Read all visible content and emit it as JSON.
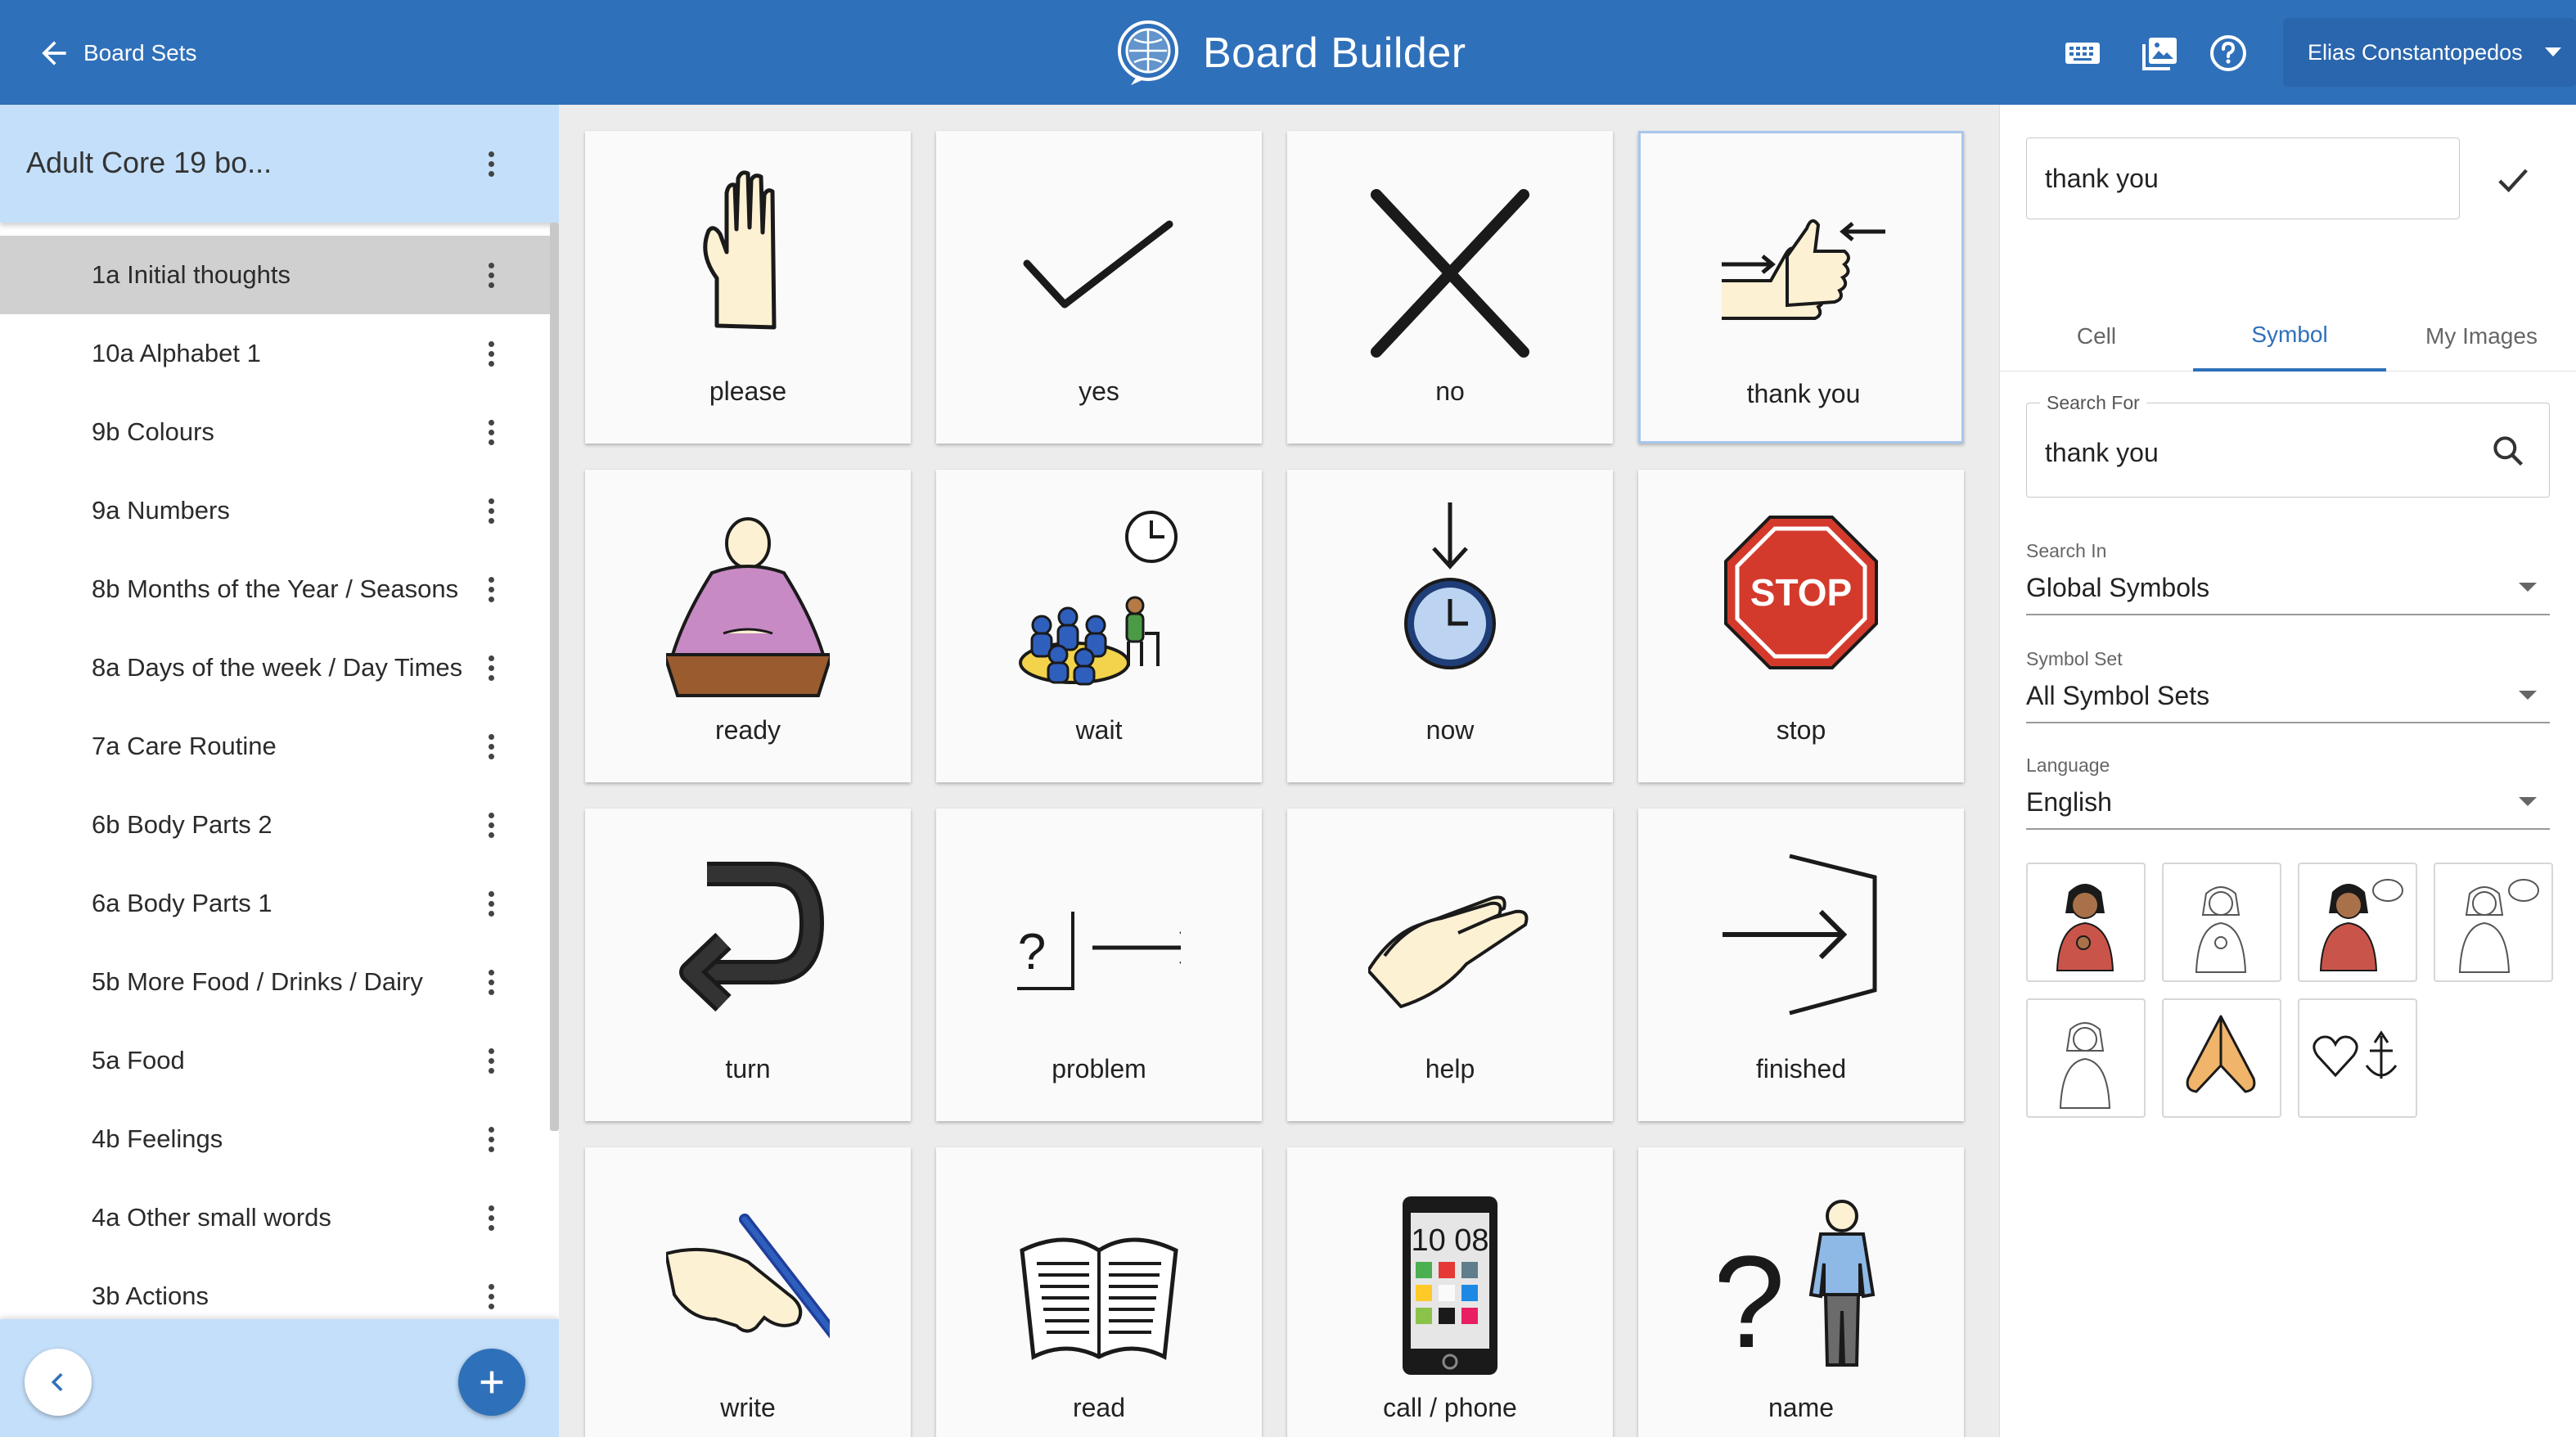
{
  "header": {
    "back_label": "Board Sets",
    "app_title": "Board Builder",
    "user_name": "Elias Constantopedos",
    "icons": [
      "keyboard-icon",
      "images-icon",
      "help-icon"
    ]
  },
  "sidebar": {
    "board_set_title": "Adult Core 19 bo...",
    "boards": [
      {
        "label": "1a Initial thoughts",
        "active": true
      },
      {
        "label": "10a Alphabet 1"
      },
      {
        "label": "9b Colours"
      },
      {
        "label": "9a Numbers"
      },
      {
        "label": "8b Months of the Year / Seasons"
      },
      {
        "label": "8a Days of the week / Day Times"
      },
      {
        "label": "7a Care Routine"
      },
      {
        "label": "6b Body Parts 2"
      },
      {
        "label": "6a Body Parts 1"
      },
      {
        "label": "5b More Food / Drinks / Dairy"
      },
      {
        "label": "5a Food"
      },
      {
        "label": "4b Feelings"
      },
      {
        "label": "4a Other small words"
      },
      {
        "label": "3b Actions"
      }
    ]
  },
  "board": {
    "cells": [
      {
        "label": "please",
        "symbol": "praying-hand"
      },
      {
        "label": "yes",
        "symbol": "checkmark"
      },
      {
        "label": "no",
        "symbol": "cross"
      },
      {
        "label": "thank you",
        "symbol": "thumbs-up-thanks",
        "selected": true
      },
      {
        "label": "ready",
        "symbol": "seated-person"
      },
      {
        "label": "wait",
        "symbol": "waiting-people-clock"
      },
      {
        "label": "now",
        "symbol": "clock-arrow-down"
      },
      {
        "label": "stop",
        "symbol": "stop-sign",
        "text_on_symbol": "STOP"
      },
      {
        "label": "turn",
        "symbol": "u-turn-arrow"
      },
      {
        "label": "problem",
        "symbol": "question-box-blocked"
      },
      {
        "label": "help",
        "symbol": "helping-hands"
      },
      {
        "label": "finished",
        "symbol": "arrow-into-bracket"
      },
      {
        "label": "write",
        "symbol": "hand-writing"
      },
      {
        "label": "read",
        "symbol": "open-book"
      },
      {
        "label": "call / phone",
        "symbol": "mobile-phone",
        "text_on_symbol": "10 08"
      },
      {
        "label": "name",
        "symbol": "question-person"
      }
    ]
  },
  "panel": {
    "cell_label_value": "thank you",
    "tabs": [
      {
        "label": "Cell"
      },
      {
        "label": "Symbol",
        "active": true
      },
      {
        "label": "My Images"
      }
    ],
    "search": {
      "legend": "Search For",
      "value": "thank you"
    },
    "search_in": {
      "label": "Search In",
      "value": "Global Symbols"
    },
    "symbol_set": {
      "label": "Symbol Set",
      "value": "All Symbol Sets"
    },
    "language": {
      "label": "Language",
      "value": "English"
    },
    "results": [
      "woman-sign-thank-you",
      "man-sign-thank-you-outline",
      "woman-sign-thank-you-speech",
      "man-sign-thank-you-speech-outline",
      "man-sign-outline",
      "praying-hands",
      "heart-anchor"
    ]
  },
  "colors": {
    "topbar": "#2f70ba",
    "sidebar_header": "#c4dffa",
    "active_item": "#d0d0d0",
    "board_bg": "#ececec",
    "accent": "#2f70ba",
    "selected_cell_border": "#a9c6ec"
  }
}
